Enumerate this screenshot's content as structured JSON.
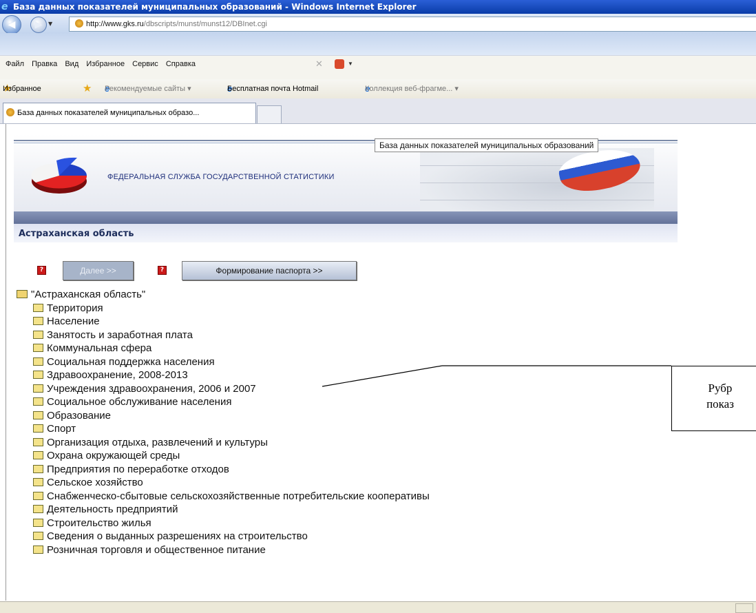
{
  "window": {
    "title": "База данных показателей муниципальных образований - Windows Internet Explorer"
  },
  "address": {
    "host": "http://www.gks.ru",
    "path": "/dbscripts/munst/munst12/DBInet.cgi"
  },
  "menu": {
    "items": [
      "Файл",
      "Правка",
      "Вид",
      "Избранное",
      "Сервис",
      "Справка"
    ]
  },
  "favorites_bar": {
    "favorites_label": "Избранное",
    "links": [
      "Рекомендуемые сайты ▾",
      "Бесплатная почта Hotmail",
      "Коллекция веб-фрагме... ▾"
    ]
  },
  "tab": {
    "title": "База данных показателей муниципальных образо..."
  },
  "banner": {
    "title": "База данных показателей муниципальных образований",
    "agency": "ФЕДЕРАЛЬНАЯ СЛУЖБА ГОСУДАРСТВЕННОЙ СТАТИСТИКИ",
    "region": "Астраханская область"
  },
  "buttons": {
    "next": "Далее >>",
    "passport": "Формирование паспорта >>"
  },
  "tree": {
    "root": "\"Астраханская область\"",
    "children": [
      "Территория",
      "Население",
      "Занятость и заработная плата",
      "Коммунальная сфера",
      "Социальная поддержка населения",
      "Здравоохранение, 2008-2013",
      "Учреждения здравоохранения, 2006 и 2007",
      "Социальное обслуживание населения",
      "Образование",
      "Спорт",
      "Организация отдыха, развлечений и культуры",
      "Охрана окружающей среды",
      "Предприятия по переработке отходов",
      "Сельское хозяйство",
      "Снабженческо-сбытовые сельскохозяйственные потребительские кооперативы",
      "Деятельность предприятий",
      "Строительство жилья",
      "Сведения о выданных разрешениях на строительство",
      "Розничная торговля и общественное питание"
    ]
  },
  "callout": {
    "line1": "Рубр",
    "line2": "показ"
  }
}
